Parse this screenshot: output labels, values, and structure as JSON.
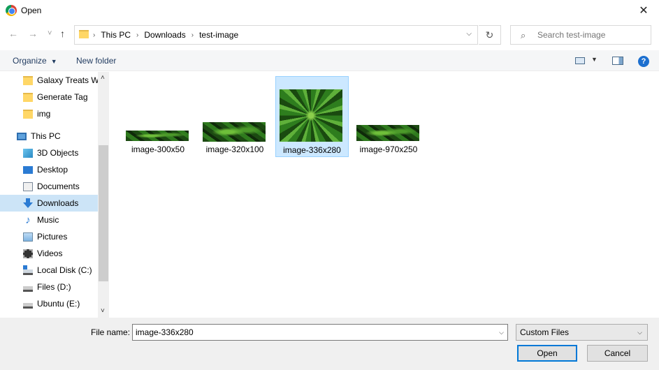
{
  "window": {
    "title": "Open",
    "close": "✕"
  },
  "nav": {
    "back": "←",
    "forward": "→",
    "recent": "˅",
    "up": "↑"
  },
  "address": {
    "crumbs": [
      "This PC",
      "Downloads",
      "test-image"
    ],
    "separator": "›",
    "dropdown": "⌵",
    "refresh": "↻"
  },
  "search": {
    "placeholder": "Search test-image",
    "icon": "⌕"
  },
  "toolbar": {
    "organize": "Organize",
    "organize_caret": "▼",
    "new_folder": "New folder",
    "view_caret": "▼",
    "help": "?"
  },
  "sidebar": {
    "scroll_up": "˄",
    "scroll_down": "˅",
    "items": [
      {
        "label": "Galaxy Treats We",
        "icon": "folder-icon"
      },
      {
        "label": "Generate Tag",
        "icon": "folder-icon"
      },
      {
        "label": "img",
        "icon": "folder-icon"
      },
      {
        "label": "This PC",
        "icon": "computer-icon"
      },
      {
        "label": "3D Objects",
        "icon": "3d-objects-icon"
      },
      {
        "label": "Desktop",
        "icon": "desktop-icon"
      },
      {
        "label": "Documents",
        "icon": "documents-icon"
      },
      {
        "label": "Downloads",
        "icon": "downloads-icon",
        "selected": true
      },
      {
        "label": "Music",
        "icon": "music-icon"
      },
      {
        "label": "Pictures",
        "icon": "pictures-icon"
      },
      {
        "label": "Videos",
        "icon": "videos-icon"
      },
      {
        "label": "Local Disk (C:)",
        "icon": "local-disk-icon"
      },
      {
        "label": "Files (D:)",
        "icon": "drive-icon"
      },
      {
        "label": "Ubuntu (E:)",
        "icon": "drive-icon"
      }
    ]
  },
  "files": [
    {
      "name": "image-300x50"
    },
    {
      "name": "image-320x100"
    },
    {
      "name": "image-336x280",
      "selected": true
    },
    {
      "name": "image-970x250"
    }
  ],
  "footer": {
    "file_name_label": "File name:",
    "file_name_value": "image-336x280",
    "dropdown": "⌵",
    "file_type": "Custom Files",
    "open_button": "Open",
    "cancel_button": "Cancel"
  },
  "colors": {
    "selection": "#cce8ff",
    "accent": "#0078d7"
  }
}
